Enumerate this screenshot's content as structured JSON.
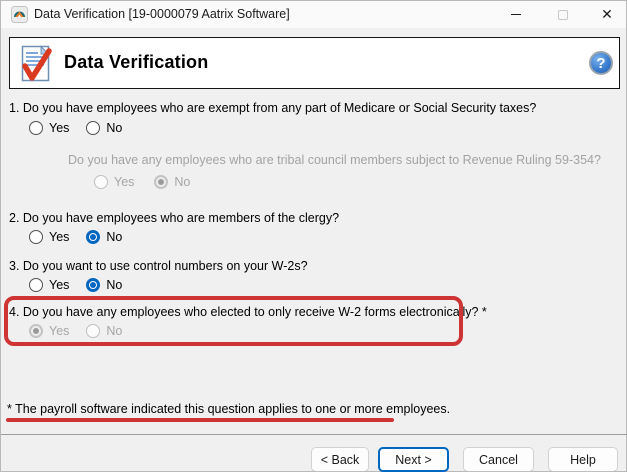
{
  "window": {
    "title": "Data Verification [19-0000079 Aatrix Software]",
    "controls": {
      "minimize_glyph": "",
      "close_glyph": "✕"
    }
  },
  "header": {
    "title": "Data Verification"
  },
  "questions": [
    {
      "text": "1. Do you have employees who are exempt from any part of Medicare or Social Security taxes?",
      "yes_label": "Yes",
      "no_label": "No",
      "selected": "none",
      "enabled": true
    },
    {
      "text": "2. Do you have employees who are members of the clergy?",
      "yes_label": "Yes",
      "no_label": "No",
      "selected": "no",
      "enabled": true
    },
    {
      "text": "3. Do you want to use control numbers on your W-2s?",
      "yes_label": "Yes",
      "no_label": "No",
      "selected": "no",
      "enabled": true
    },
    {
      "text": "4. Do you have any employees who elected to only receive W-2 forms electronically? *",
      "yes_label": "Yes",
      "no_label": "No",
      "selected": "yes",
      "enabled": false,
      "highlighted": true
    }
  ],
  "sub_question": {
    "text": "Do you have any employees who are tribal council members subject to Revenue Ruling 59-354?",
    "yes_label": "Yes",
    "no_label": "No",
    "selected": "no",
    "enabled": false
  },
  "footnote": "* The payroll software indicated this question applies to one or more employees.",
  "buttons": {
    "back": "< Back",
    "next": "Next >",
    "cancel": "Cancel",
    "help": "Help"
  },
  "colors": {
    "accent_blue": "#0067c0",
    "annotation_red": "#ce3434"
  }
}
